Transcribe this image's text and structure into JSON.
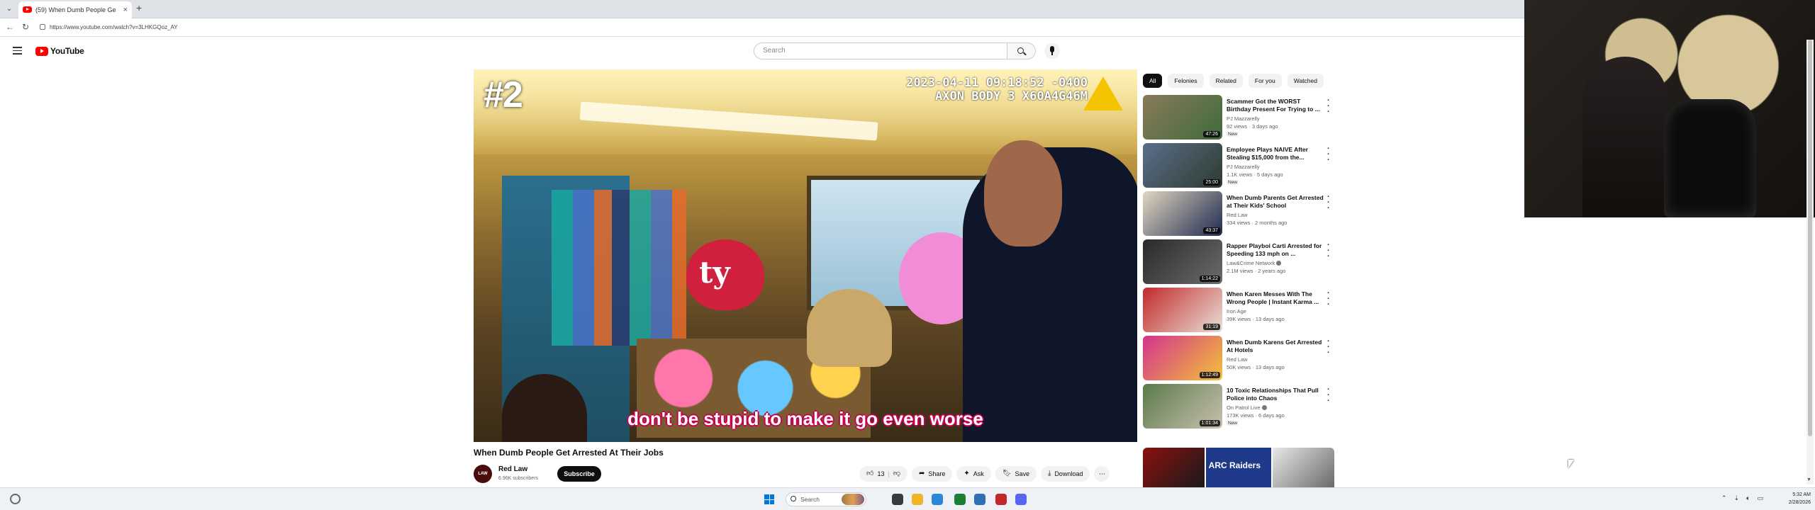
{
  "browser": {
    "tab_title": "(59) When Dumb People Ge",
    "url": "https://www.youtube.com/watch?v=3LHKGQoz_AY"
  },
  "youtube": {
    "logo_text": "YouTube",
    "search_placeholder": "Search"
  },
  "video": {
    "rank_badge": "#2",
    "timestamp_line1": "2023-04-11 09:18:52 -0400",
    "timestamp_line2": "AXON BODY 3 X60A4G46M",
    "subtitle": "don't be stupid to make it go even worse",
    "title": "When Dumb People Get Arrested At Their Jobs",
    "channel": "Red Law",
    "avatar_text": "LAW",
    "subscribers": "6.96K subscribers",
    "subscribe_label": "Subscribe",
    "likes": "13",
    "share_label": "Share",
    "ask_label": "Ask",
    "save_label": "Save",
    "download_label": "Download"
  },
  "chips": [
    "All",
    "Felonies",
    "Related",
    "For you",
    "Watched"
  ],
  "recommendations": [
    {
      "title": "Scammer Got the WORST Birthday Present For Trying to ...",
      "channel": "PJ Mazzarelly",
      "meta": "92 views · 3 days ago",
      "badge": "New",
      "duration": "47:26",
      "verified": false,
      "colors": [
        "#8a7a5a",
        "#3e6b3a"
      ]
    },
    {
      "title": "Employee Plays NAIVE After Stealing $15,000 from the...",
      "channel": "PJ Mazzarelly",
      "meta": "1.1K views · 5 days ago",
      "badge": "New",
      "duration": "25:00",
      "verified": false,
      "colors": [
        "#5a6f8a",
        "#2e3a30"
      ]
    },
    {
      "title": "When Dumb Parents Get Arrested at Their Kids' School",
      "channel": "Red Law",
      "meta": "334 views · 2 months ago",
      "badge": "",
      "duration": "43:37",
      "verified": false,
      "colors": [
        "#e0d6c0",
        "#1f2a50"
      ]
    },
    {
      "title": "Rapper Playboi Carti Arrested for Speeding 133 mph on ...",
      "channel": "Law&Crime Network",
      "meta": "2.1M views · 2 years ago",
      "badge": "",
      "duration": "1:14:22",
      "verified": true,
      "colors": [
        "#2a2a2a",
        "#6b6b6b"
      ]
    },
    {
      "title": "When Karen Messes With The Wrong People | Instant Karma ...",
      "channel": "Iron Age",
      "meta": "39K views · 13 days ago",
      "badge": "",
      "duration": "31:19",
      "verified": false,
      "colors": [
        "#c22a2a",
        "#e8e0d8"
      ]
    },
    {
      "title": "When Dumb Karens Get Arrested At Hotels",
      "channel": "Red Law",
      "meta": "50K views · 13 days ago",
      "badge": "",
      "duration": "1:12:49",
      "verified": false,
      "colors": [
        "#d4338c",
        "#f2c23a"
      ]
    },
    {
      "title": "10 Toxic Relationships That Pull Police into Chaos",
      "channel": "On Patrol Live",
      "meta": "173K views · 6 days ago",
      "badge": "New",
      "duration": "1:01:34",
      "verified": true,
      "colors": [
        "#5a7a4a",
        "#c9c0b0"
      ]
    }
  ],
  "partial_rec": {
    "text": "ARC Raiders"
  },
  "taskbar": {
    "search_label": "Search",
    "time": "5:32 AM",
    "date": "2/28/2026"
  },
  "icons": [
    "youtube-favicon",
    "close-icon",
    "new-tab-icon",
    "back-icon",
    "reload-icon",
    "menu-icon",
    "search-icon",
    "mic-icon",
    "like-icon",
    "dislike-icon",
    "share-icon",
    "ask-icon",
    "save-icon",
    "download-icon",
    "more-icon",
    "windows-start-icon"
  ]
}
